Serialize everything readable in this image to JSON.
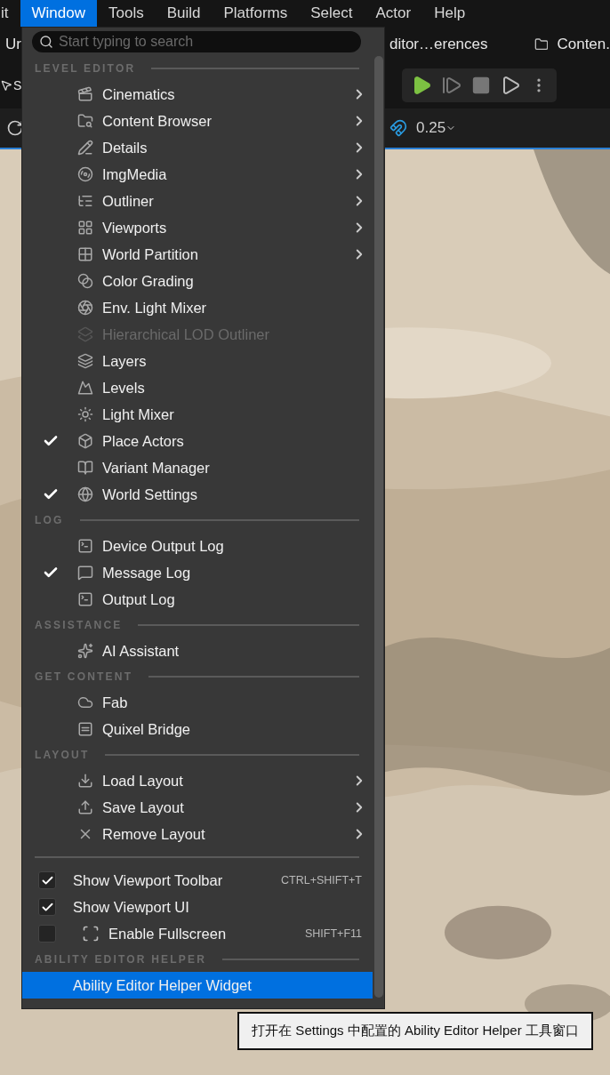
{
  "menubar": [
    {
      "label": "it",
      "selected": false
    },
    {
      "label": "Window",
      "selected": true
    },
    {
      "label": "Tools",
      "selected": false
    },
    {
      "label": "Build",
      "selected": false
    },
    {
      "label": "Platforms",
      "selected": false
    },
    {
      "label": "Select",
      "selected": false
    },
    {
      "label": "Actor",
      "selected": false
    },
    {
      "label": "Help",
      "selected": false
    }
  ],
  "toolbar": {
    "tab_left": "Ur",
    "tab_middle": "ditor…erences",
    "tab_right": "Conten.",
    "mode_label": "S",
    "snap_value": "0.25"
  },
  "menu": {
    "search": {
      "placeholder": "Start typing to search"
    },
    "sections": [
      {
        "title": "LEVEL EDITOR",
        "items": [
          {
            "label": "Cinematics",
            "checked": false,
            "submenu": true,
            "disabled": false
          },
          {
            "label": "Content Browser",
            "checked": false,
            "submenu": true,
            "disabled": false
          },
          {
            "label": "Details",
            "checked": false,
            "submenu": true,
            "disabled": false
          },
          {
            "label": "ImgMedia",
            "checked": false,
            "submenu": true,
            "disabled": false
          },
          {
            "label": "Outliner",
            "checked": false,
            "submenu": true,
            "disabled": false
          },
          {
            "label": "Viewports",
            "checked": false,
            "submenu": true,
            "disabled": false
          },
          {
            "label": "World Partition",
            "checked": false,
            "submenu": true,
            "disabled": false
          },
          {
            "label": "Color Grading",
            "checked": false,
            "submenu": false,
            "disabled": false
          },
          {
            "label": "Env. Light Mixer",
            "checked": false,
            "submenu": false,
            "disabled": false
          },
          {
            "label": "Hierarchical LOD Outliner",
            "checked": false,
            "submenu": false,
            "disabled": true
          },
          {
            "label": "Layers",
            "checked": false,
            "submenu": false,
            "disabled": false
          },
          {
            "label": "Levels",
            "checked": false,
            "submenu": false,
            "disabled": false
          },
          {
            "label": "Light Mixer",
            "checked": false,
            "submenu": false,
            "disabled": false
          },
          {
            "label": "Place Actors",
            "checked": true,
            "submenu": false,
            "disabled": false
          },
          {
            "label": "Variant Manager",
            "checked": false,
            "submenu": false,
            "disabled": false
          },
          {
            "label": "World Settings",
            "checked": true,
            "submenu": false,
            "disabled": false
          }
        ]
      },
      {
        "title": "LOG",
        "items": [
          {
            "label": "Device Output Log",
            "checked": false,
            "submenu": false,
            "disabled": false
          },
          {
            "label": "Message Log",
            "checked": true,
            "submenu": false,
            "disabled": false
          },
          {
            "label": "Output Log",
            "checked": false,
            "submenu": false,
            "disabled": false
          }
        ]
      },
      {
        "title": "ASSISTANCE",
        "items": [
          {
            "label": "AI Assistant",
            "checked": false,
            "submenu": false,
            "disabled": false
          }
        ]
      },
      {
        "title": "GET CONTENT",
        "items": [
          {
            "label": "Fab",
            "checked": false,
            "submenu": false,
            "disabled": false
          },
          {
            "label": "Quixel Bridge",
            "checked": false,
            "submenu": false,
            "disabled": false
          }
        ]
      },
      {
        "title": "LAYOUT",
        "items": [
          {
            "label": "Load Layout",
            "checked": false,
            "submenu": true,
            "disabled": false
          },
          {
            "label": "Save Layout",
            "checked": false,
            "submenu": true,
            "disabled": false
          },
          {
            "label": "Remove Layout",
            "checked": false,
            "submenu": true,
            "disabled": false
          }
        ]
      },
      {
        "items": [
          {
            "kind": "checkbox",
            "label": "Show Viewport Toolbar",
            "checked": true,
            "shortcut": "CTRL+SHIFT+T"
          },
          {
            "kind": "checkbox",
            "label": "Show Viewport UI",
            "checked": true
          },
          {
            "kind": "checkbox",
            "label": "Enable Fullscreen",
            "checked": false,
            "shortcut": "SHIFT+F11"
          }
        ]
      },
      {
        "title": "ABILITY EDITOR HELPER",
        "items": [
          {
            "kind": "plain",
            "label": "Ability Editor Helper Widget",
            "highlighted": true
          }
        ]
      }
    ]
  },
  "tooltip": "打开在 Settings 中配置的 Ability Editor Helper 工具窗口"
}
